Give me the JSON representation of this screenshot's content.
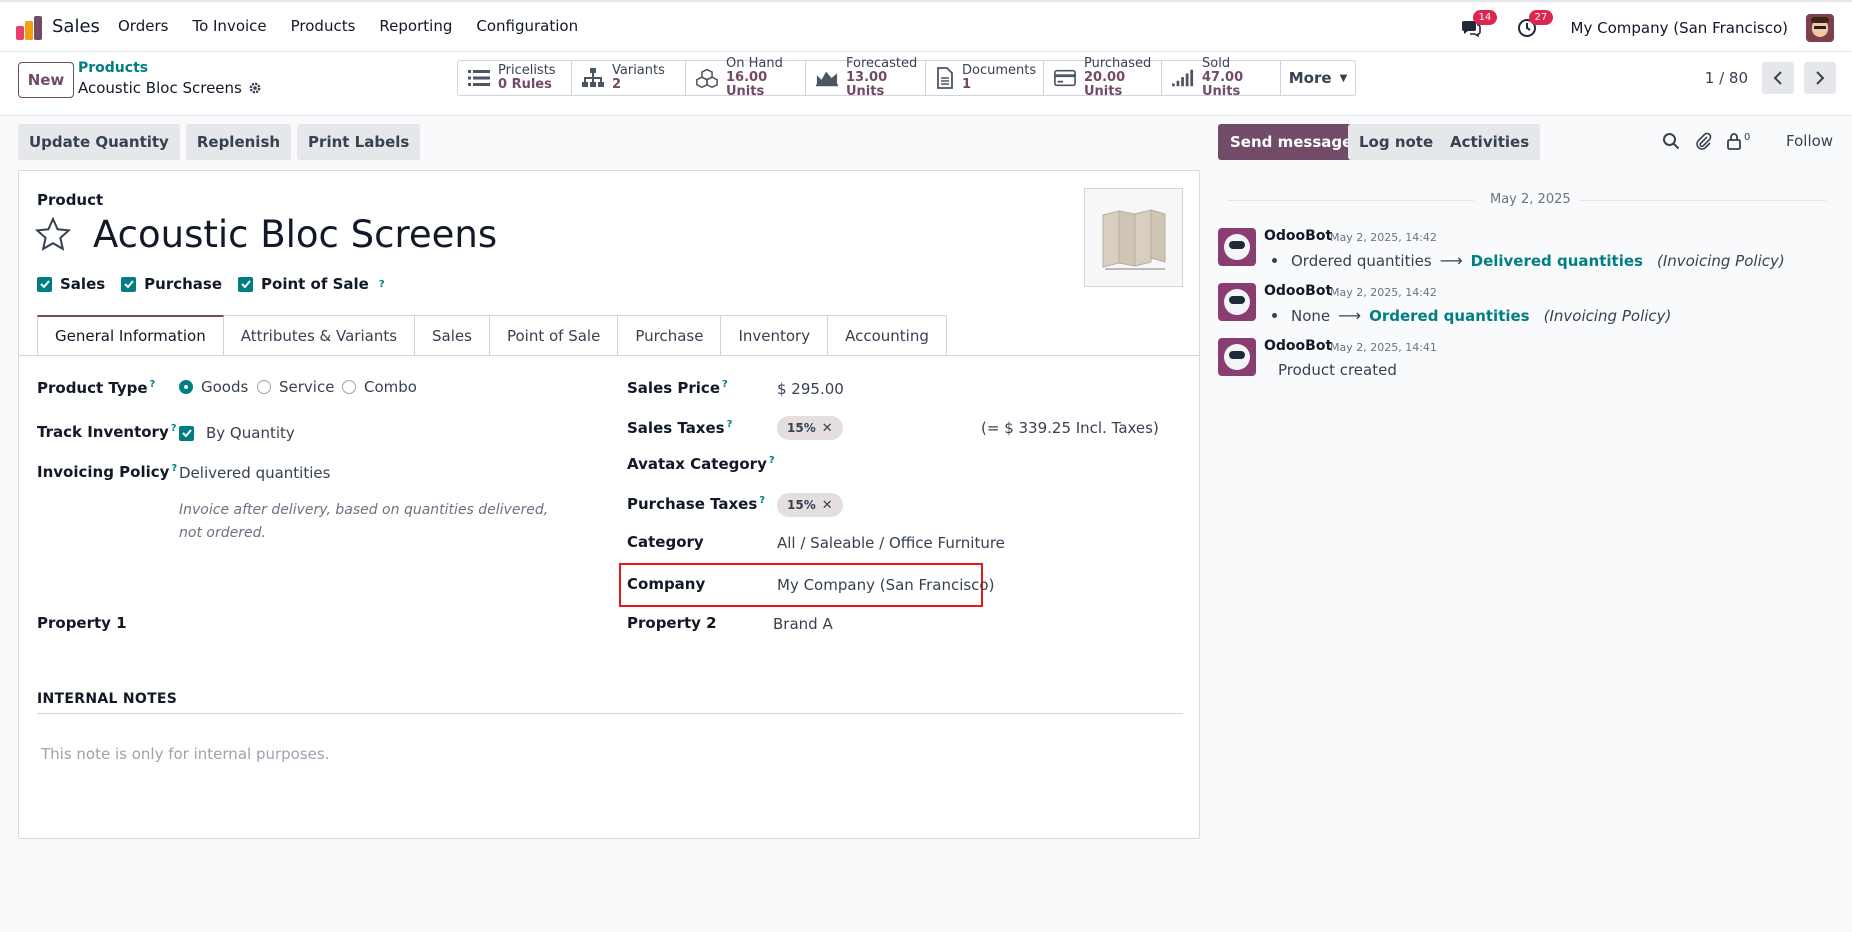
{
  "topbar": {
    "app_name": "Sales",
    "menu": [
      "Orders",
      "To Invoice",
      "Products",
      "Reporting",
      "Configuration"
    ],
    "messages_count": "14",
    "activities_count": "27",
    "company": "My Company (San Francisco)"
  },
  "control": {
    "new_label": "New",
    "breadcrumb_parent": "Products",
    "breadcrumb_current": "Acoustic Bloc Screens",
    "smart_buttons": [
      {
        "name": "Pricelists",
        "value": "0 Rules",
        "icon": "list-icon"
      },
      {
        "name": "Variants",
        "value": "2",
        "icon": "sitemap-icon"
      },
      {
        "name": "On Hand",
        "value": "16.00 Units",
        "icon": "cubes-icon"
      },
      {
        "name": "Forecasted",
        "value": "13.00 Units",
        "icon": "area-chart-icon"
      },
      {
        "name": "Documents",
        "value": "1",
        "icon": "file-icon"
      },
      {
        "name": "Purchased",
        "value": "20.00 Units",
        "icon": "credit-card-icon"
      },
      {
        "name": "Sold",
        "value": "47.00 Units",
        "icon": "signal-icon"
      }
    ],
    "more_label": "More",
    "pager": "1 / 80"
  },
  "actions": [
    "Update Quantity",
    "Replenish",
    "Print Labels"
  ],
  "form": {
    "type_label": "Product",
    "title": "Acoustic Bloc Screens",
    "checks": [
      "Sales",
      "Purchase",
      "Point of Sale"
    ],
    "tabs": [
      "General Information",
      "Attributes & Variants",
      "Sales",
      "Point of Sale",
      "Purchase",
      "Inventory",
      "Accounting"
    ],
    "product_type_label": "Product Type",
    "product_type_options": [
      "Goods",
      "Service",
      "Combo"
    ],
    "track_inventory_label": "Track Inventory",
    "track_inventory_value": "By Quantity",
    "invoicing_policy_label": "Invoicing Policy",
    "invoicing_policy_value": "Delivered quantities",
    "invoicing_hint": "Invoice after delivery, based on quantities delivered, not ordered.",
    "property1_label": "Property 1",
    "sales_price_label": "Sales Price",
    "sales_price_value": "$ 295.00",
    "sales_taxes_label": "Sales Taxes",
    "sales_tax_tag": "15%",
    "incl_taxes": "(= $ 339.25 Incl. Taxes)",
    "avatax_label": "Avatax Category",
    "purchase_taxes_label": "Purchase Taxes",
    "purchase_tax_tag": "15%",
    "category_label": "Category",
    "category_value": "All / Saleable / Office Furniture",
    "company_label": "Company",
    "company_value": "My Company (San Francisco)",
    "property2_label": "Property 2",
    "property2_value": "Brand A",
    "notes_header": "INTERNAL NOTES",
    "notes_placeholder": "This note is only for internal purposes."
  },
  "chatter": {
    "send_message": "Send message",
    "log_note": "Log note",
    "activities": "Activities",
    "followers_count": "0",
    "follow": "Follow",
    "date_separator": "May 2, 2025",
    "messages": [
      {
        "author": "OdooBot",
        "time": "May 2, 2025, 14:42",
        "from": "Ordered quantities",
        "to": "Delivered quantities",
        "field": "(Invoicing Policy)"
      },
      {
        "author": "OdooBot",
        "time": "May 2, 2025, 14:42",
        "from": "None",
        "to": "Ordered quantities",
        "field": "(Invoicing Policy)"
      },
      {
        "author": "OdooBot",
        "time": "May 2, 2025, 14:41",
        "text": "Product created"
      }
    ]
  }
}
